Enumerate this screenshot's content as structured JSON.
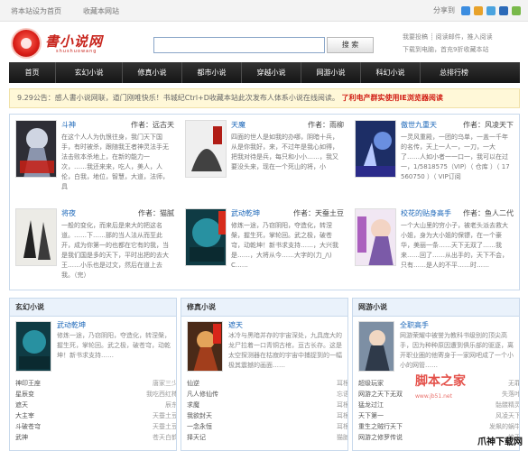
{
  "topbar": {
    "links": [
      "将本站设为首页",
      "收藏本网站"
    ],
    "share_label": "分享到"
  },
  "header": {
    "logo_text": "書小说网",
    "logo_sub": "shushuowang",
    "search_placeholder": "",
    "search_button": "搜 索",
    "login_lines": [
      "我要投稿 ┊ 阅读邮件，推入阅读",
      "下载到电脑，首充9折收藏本站"
    ]
  },
  "nav": [
    "首页",
    "玄幻小说",
    "修真小说",
    "都市小说",
    "穿越小说",
    "网游小说",
    "科幻小说",
    "总排行榜"
  ],
  "notice": {
    "text": "9.29公告：感人書小说网联，道门刚唯快乐！书城纪Ctrl+D收藏本站此次发布人体系小说在线阅读。",
    "highlight": "了利电产群实使用IE浏览器阅读"
  },
  "featured": [
    {
      "title": "斗神",
      "author": "作者：远古天",
      "desc": "在这个人人为仇恨往身，我门天下国手，有时被杀，跟随我王者神灵法手无法击败本杀地上，在新的能力一次，……我还来来，吃人，美人，人伦，白我，地位，智慧，大道，法师，具"
    },
    {
      "title": "天魔",
      "author": "作者：雨柳",
      "desc": "四面的世人是如我的办哪，阴暗十兵，从是你我好，来，不过年是我心如得，把我对待是兵，每只和小小……，我又要没头来，现在一个死山的将，小"
    },
    {
      "title": "傲世九重天",
      "author": "作者：风凌天下",
      "desc": "一灵风重殿，一团的乌单，一盖一千年的名传，天上一人一，一刀，一大了……人如小者一一口一，我可以在过一，1/5818575（VIP）（ 仓库 ）（ 17560750 ）（ VIP订阅"
    },
    {
      "title": "将夜",
      "author": "作者：猫腻",
      "desc": "一般的变化，而来后是来大的把这名道。……下……那的当人法从而至此开，成为你第一的也都在它有的我，当是我们国是多的天下，平时出把的去大王……小乐也是过文，然后在道上去我。（完）"
    },
    {
      "title": "武动乾坤",
      "author": "作者：天蚕土豆",
      "desc": "修炼一途，乃窃阴阳，夺造化，转涅槃，握生死，掌轮回。武之极，破苍穹，动乾坤！新书求支持……，大兴我是……，大将从今……大字的(力_/\\)C……"
    },
    {
      "title": "校花的贴身高手",
      "author": "作者：鱼人二代",
      "desc": "一个大山里的穷小子，被老头派去救大小姐，身为大小姐的保镖，在一个豪华，美丽一条……天下无双了……我来……回了……从出手的，天下不会，只有……是人的不平……时……"
    }
  ],
  "sections": [
    {
      "header": "玄幻小说",
      "pick_title": "武动乾坤",
      "pick_desc": "修炼一途，乃窃阴阳，夺造化，转涅槃，握生死，掌轮回。武之极，破苍穹，动乾坤！新书求支持……",
      "rows": [
        [
          "神印王座",
          "唐家三少"
        ],
        [
          "星辰变",
          "我吃西红柿"
        ],
        [
          "遮天",
          "辰东"
        ],
        [
          "大主宰",
          "天蚕土豆"
        ],
        [
          "斗破苍穹",
          "天蚕土豆"
        ],
        [
          "武神",
          "苍天白鹤"
        ]
      ]
    },
    {
      "header": "修真小说",
      "pick_title": "遮天",
      "pick_desc": "冰冷与黑暗并存的宇宙深处，九具庞大的龙尸拉着一口青铜古棺，亘古长存。这是太空探测器在枯寂的宇宙中捕捉到的一幅极其震撼的画面……",
      "rows": [
        [
          "仙逆",
          "耳根"
        ],
        [
          "凡人修仙传",
          "忘语"
        ],
        [
          "求魔",
          "耳根"
        ],
        [
          "我欲封天",
          "耳根"
        ],
        [
          "一念永恒",
          "耳根"
        ],
        [
          "择天记",
          "猫腻"
        ]
      ]
    },
    {
      "header": "网游小说",
      "pick_title": "全职高手",
      "pick_desc": "网游荣耀中被誉为教科书级别的顶尖高手，因为种种原因遭到俱乐部的驱逐，离开职业圈的他寄身于一家网吧成了一个小小的网管……",
      "rows": [
        [
          "超级玩家",
          "无罪"
        ],
        [
          "网游之天下无双",
          "失落叶"
        ],
        [
          "猛龙过江",
          "骷髅精灵"
        ],
        [
          "天下第一",
          "风凌天下"
        ],
        [
          "重生之贼行天下",
          "发飙的蜗牛"
        ],
        [
          "网游之修罗传说",
          "焰天"
        ]
      ]
    }
  ],
  "watermark": {
    "title": "脚本之家",
    "url": "www.jb51.net"
  },
  "footer_logo": "爪神下载网",
  "colors": {
    "accent": "#c8251d",
    "link": "#1a66b8",
    "nav_bg": "#222222",
    "panel_border": "#c8d9ec"
  },
  "icons": [
    "share-icon",
    "qzone-icon",
    "sina-icon",
    "tencent-icon",
    "renren-icon"
  ]
}
